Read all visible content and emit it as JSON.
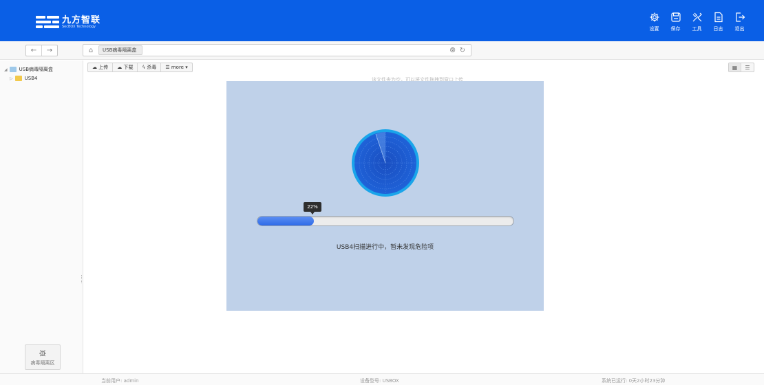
{
  "header": {
    "logo_text": "九方智联",
    "logo_subtext": "SecBOX Technology",
    "nav": [
      {
        "label": "设置",
        "icon": "gear-icon"
      },
      {
        "label": "保存",
        "icon": "save-icon"
      },
      {
        "label": "工具",
        "icon": "tools-icon"
      },
      {
        "label": "日志",
        "icon": "log-icon"
      },
      {
        "label": "退出",
        "icon": "logout-icon"
      }
    ]
  },
  "address": {
    "breadcrumb": "USB病毒隔离盒"
  },
  "sidebar": {
    "tree": [
      {
        "label": "USB病毒隔离盒",
        "icon": "usb-box-icon"
      },
      {
        "label": "USB4",
        "icon": "folder-icon"
      }
    ],
    "quarantine_label": "病毒隔离区"
  },
  "toolbar": {
    "upload": "上传",
    "download": "下载",
    "kill": "杀毒",
    "more": "more"
  },
  "hint": "该文件夹为空，可以将文件拖拽到窗口上传",
  "scan": {
    "progress": 0.22,
    "progress_label": "22%",
    "status_text": "USB4扫描进行中，暂未发现危险项"
  },
  "statusbar": {
    "user": "当前用户: admin",
    "model": "设备型号: USBOX",
    "uptime": "系统已运行: 0天2小时23分钟"
  },
  "colors": {
    "header_bg": "#0a5fe6",
    "panel_bg": "#bfd1e9",
    "progress_fill": "#2f6be8"
  }
}
